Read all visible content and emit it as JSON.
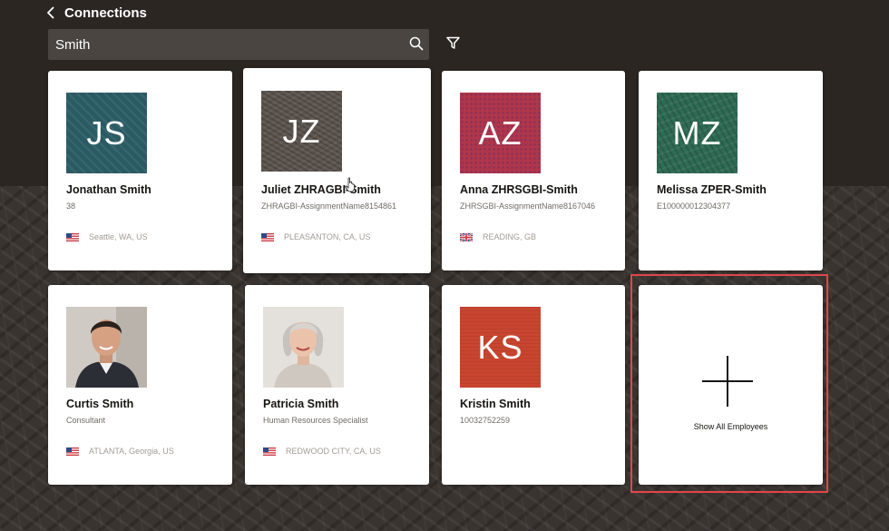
{
  "header": {
    "title": "Connections"
  },
  "search": {
    "value": "Smith"
  },
  "cards": [
    {
      "initials": "JS",
      "name": "Jonathan Smith",
      "subtitle": "38",
      "location": "Seattle, WA, US",
      "flag": "us"
    },
    {
      "initials": "JZ",
      "name": "Juliet ZHRAGBI-Smith",
      "subtitle": "ZHRAGBI-AssignmentName8154861",
      "location": "PLEASANTON, CA, US",
      "flag": "us"
    },
    {
      "initials": "AZ",
      "name": "Anna ZHRSGBI-Smith",
      "subtitle": "ZHRSGBI-AssignmentName8167046",
      "location": "READING, GB",
      "flag": "gb"
    },
    {
      "initials": "MZ",
      "name": "Melissa ZPER-Smith",
      "subtitle": "E100000012304377",
      "location": "",
      "flag": ""
    },
    {
      "initials": "",
      "name": "Curtis Smith",
      "subtitle": "Consultant",
      "location": "ATLANTA, Georgia, US",
      "flag": "us"
    },
    {
      "initials": "",
      "name": "Patricia Smith",
      "subtitle": "Human Resources Specialist",
      "location": "REDWOOD CITY, CA, US",
      "flag": "us"
    },
    {
      "initials": "KS",
      "name": "Kristin Smith",
      "subtitle": "10032752259",
      "location": "",
      "flag": ""
    }
  ],
  "show_all": {
    "label": "Show All Employees"
  },
  "colors": {
    "js": "#2a5b63",
    "jz": "#5e5650",
    "az": "#b0364a",
    "mz": "#2f6b54",
    "ks": "#c9452f",
    "focus": "#e0464a"
  },
  "icons": [
    "back-icon",
    "search-icon",
    "filter-icon",
    "flag-us-icon",
    "flag-gb-icon",
    "plus-icon",
    "pointer-cursor-icon"
  ]
}
